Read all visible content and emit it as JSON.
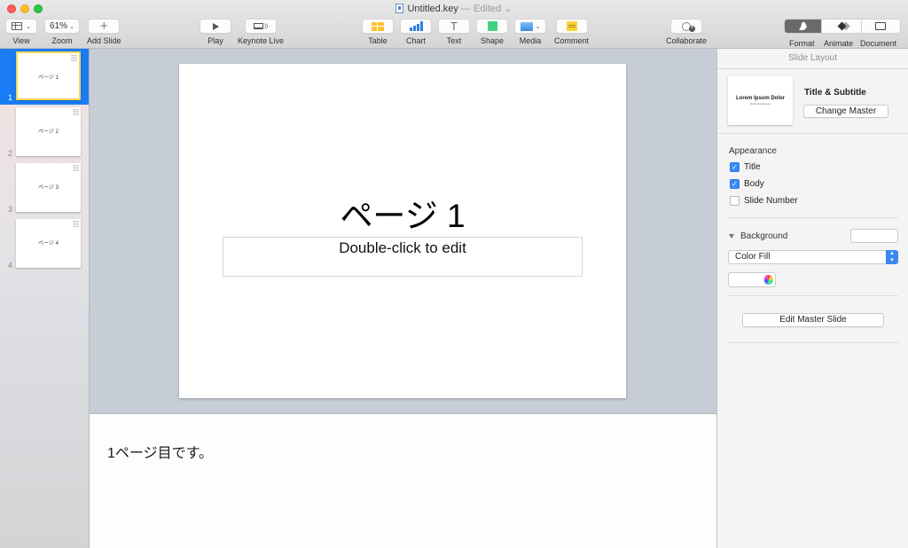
{
  "window": {
    "filename": "Untitled.key",
    "status": "— Edited ⌄"
  },
  "toolbar": {
    "view": {
      "label": "View",
      "icon": "sidebar-layout-icon"
    },
    "zoom": {
      "label": "Zoom",
      "value": "61%"
    },
    "add_slide": {
      "label": "Add Slide",
      "icon": "plus-icon"
    },
    "play": {
      "label": "Play",
      "icon": "play-icon"
    },
    "keynote_live": {
      "label": "Keynote Live",
      "icon": "broadcast-laptop-icon"
    },
    "table": {
      "label": "Table",
      "icon": "table-icon"
    },
    "chart": {
      "label": "Chart",
      "icon": "bar-chart-icon"
    },
    "text": {
      "label": "Text",
      "icon": "text-icon",
      "glyph": "T"
    },
    "shape": {
      "label": "Shape",
      "icon": "shape-icon"
    },
    "media": {
      "label": "Media",
      "icon": "photo-icon"
    },
    "comment": {
      "label": "Comment",
      "icon": "comment-icon"
    },
    "collaborate": {
      "label": "Collaborate",
      "icon": "add-person-icon"
    },
    "format": {
      "label": "Format",
      "icon": "paintbrush-icon",
      "active": true
    },
    "animate": {
      "label": "Animate",
      "icon": "diamond-icon"
    },
    "document": {
      "label": "Document",
      "icon": "document-icon"
    }
  },
  "navigator": {
    "slides": [
      {
        "number": "1",
        "title": "ページ 1",
        "selected": true
      },
      {
        "number": "2",
        "title": "ページ 2",
        "selected": false
      },
      {
        "number": "3",
        "title": "ページ 3",
        "selected": false
      },
      {
        "number": "4",
        "title": "ページ 4",
        "selected": false
      }
    ]
  },
  "slide": {
    "title": "ページ 1",
    "body_placeholder": "Double-click to edit"
  },
  "notes": {
    "text": "1ページ目です。"
  },
  "inspector": {
    "header": "Slide Layout",
    "master_thumb_title": "Lorem Ipsum Dolor",
    "master_thumb_subtitle": "Nostrud quis tune",
    "layout_name": "Title & Subtitle",
    "change_master": "Change Master",
    "appearance_label": "Appearance",
    "appearance": [
      {
        "label": "Title",
        "checked": true
      },
      {
        "label": "Body",
        "checked": true
      },
      {
        "label": "Slide Number",
        "checked": false
      }
    ],
    "background_label": "Background",
    "fill_type": "Color Fill",
    "fill_color": "#ffffff",
    "edit_master": "Edit Master Slide"
  },
  "colors": {
    "selection": "#1a7cf5",
    "thumb_highlight": "#f3d65a",
    "checkbox_accent": "#3c8bf5",
    "canvas_bg": "#c6cdd6"
  }
}
